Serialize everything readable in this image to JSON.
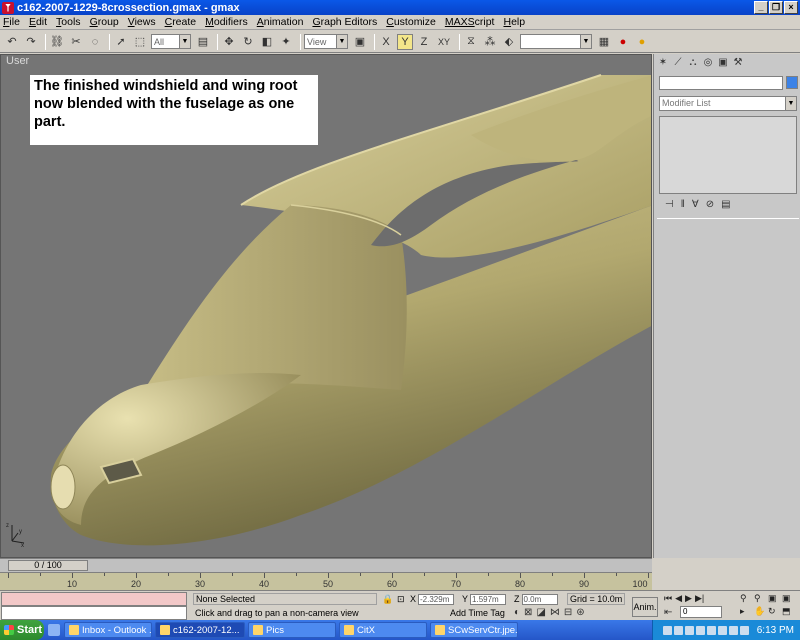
{
  "window": {
    "title": "c162-2007-1229-8crossection.gmax - gmax"
  },
  "menu": [
    {
      "u": "F",
      "rest": "ile"
    },
    {
      "u": "E",
      "rest": "dit"
    },
    {
      "u": "T",
      "rest": "ools"
    },
    {
      "u": "G",
      "rest": "roup"
    },
    {
      "u": "V",
      "rest": "iews"
    },
    {
      "u": "C",
      "rest": "reate"
    },
    {
      "u": "M",
      "rest": "odifiers"
    },
    {
      "u": "A",
      "rest": "nimation"
    },
    {
      "u": "G",
      "rest": "raph Editors"
    },
    {
      "u": "C",
      "rest": "ustomize"
    },
    {
      "u": "MAXS",
      "rest": "cript"
    },
    {
      "u": "H",
      "rest": "elp"
    }
  ],
  "toolbar": {
    "selection_filter": "All",
    "reference_coord": "View",
    "axis_x": "X",
    "axis_y": "Y",
    "axis_z": "Z",
    "axis_xy": "XY"
  },
  "viewport": {
    "label": "User",
    "note": "The finished windshield and wing root now blended with the fuselage as one part.",
    "axis_x": "x",
    "axis_y": "y",
    "axis_z": "z"
  },
  "command_panel": {
    "modifier_list": "Modifier List",
    "object_color": "#3c82e6"
  },
  "timeline": {
    "slider": "0 / 100",
    "ticks": [
      "10",
      "20",
      "30",
      "40",
      "50",
      "60",
      "70",
      "80",
      "90",
      "100"
    ]
  },
  "status": {
    "selection": "None Selected",
    "prompt": "Click and drag to pan a non-camera view",
    "x_label": "X",
    "x_value": "-2.329m",
    "y_label": "Y",
    "y_value": "1.597m",
    "z_label": "Z",
    "z_value": "0.0m",
    "grid": "Grid = 10.0m",
    "add_time_tag": "Add Time Tag",
    "anim": "Anim.",
    "frame": "0"
  },
  "taskbar": {
    "start": "Start",
    "tasks": [
      {
        "label": "Inbox - Outlook ...",
        "active": false
      },
      {
        "label": "c162-2007-12...",
        "active": true
      },
      {
        "label": "Pics",
        "active": false
      },
      {
        "label": "CitX",
        "active": false
      },
      {
        "label": "SCwServCtr.jpe...",
        "active": false
      }
    ],
    "clock": "6:13 PM"
  }
}
